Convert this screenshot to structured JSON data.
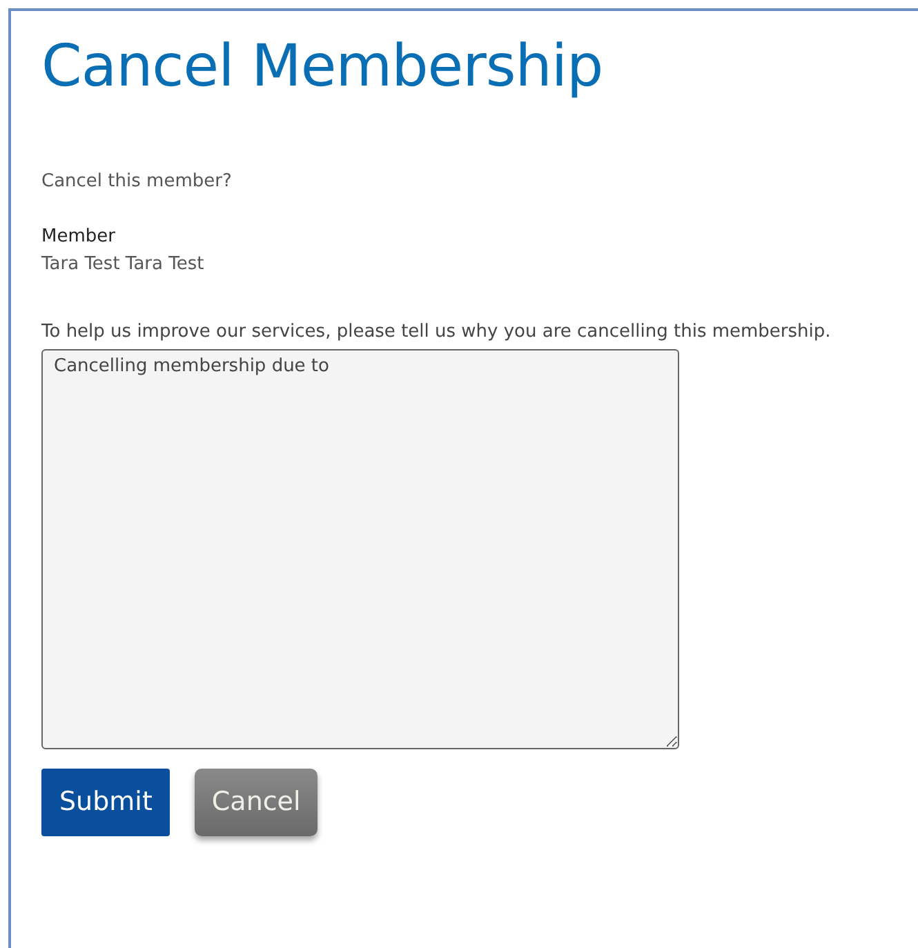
{
  "title": "Cancel Membership",
  "prompt": "Cancel this member?",
  "member": {
    "label": "Member",
    "value": "Tara Test Tara Test"
  },
  "reason": {
    "label": "To help us improve our services, please tell us why you are cancelling this membership.",
    "value": "Cancelling membership due to"
  },
  "buttons": [
    {
      "label": "Submit",
      "kind": "primary"
    },
    {
      "label": "Cancel",
      "kind": "secondary"
    }
  ]
}
